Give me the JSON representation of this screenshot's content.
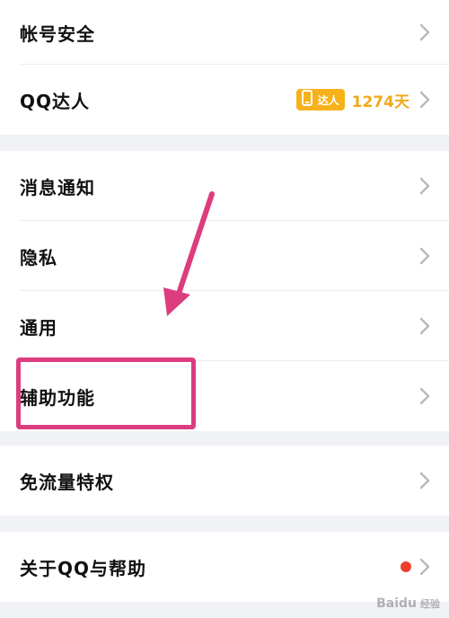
{
  "settings": {
    "group1": [
      {
        "label": "帐号安全"
      },
      {
        "label": "QQ达人",
        "badge_text": "达人",
        "days": "1274天"
      }
    ],
    "group2": [
      {
        "label": "消息通知"
      },
      {
        "label": "隐私"
      },
      {
        "label": "通用"
      },
      {
        "label": "辅助功能"
      }
    ],
    "group3": [
      {
        "label": "免流量特权"
      }
    ],
    "group4": [
      {
        "label": "关于QQ与帮助"
      }
    ]
  },
  "annotations": {
    "arrow_color": "#dc3d7f",
    "highlight_color": "#dc3d7f"
  },
  "watermark": {
    "brand": "Baidu",
    "sub": "经验"
  },
  "colors": {
    "accent_gold": "#f7b21b",
    "notification_dot": "#f0402c",
    "background": "#f1f2f6"
  },
  "icons": [
    "chevron-right-icon",
    "phone-badge-icon",
    "red-dot-icon"
  ]
}
